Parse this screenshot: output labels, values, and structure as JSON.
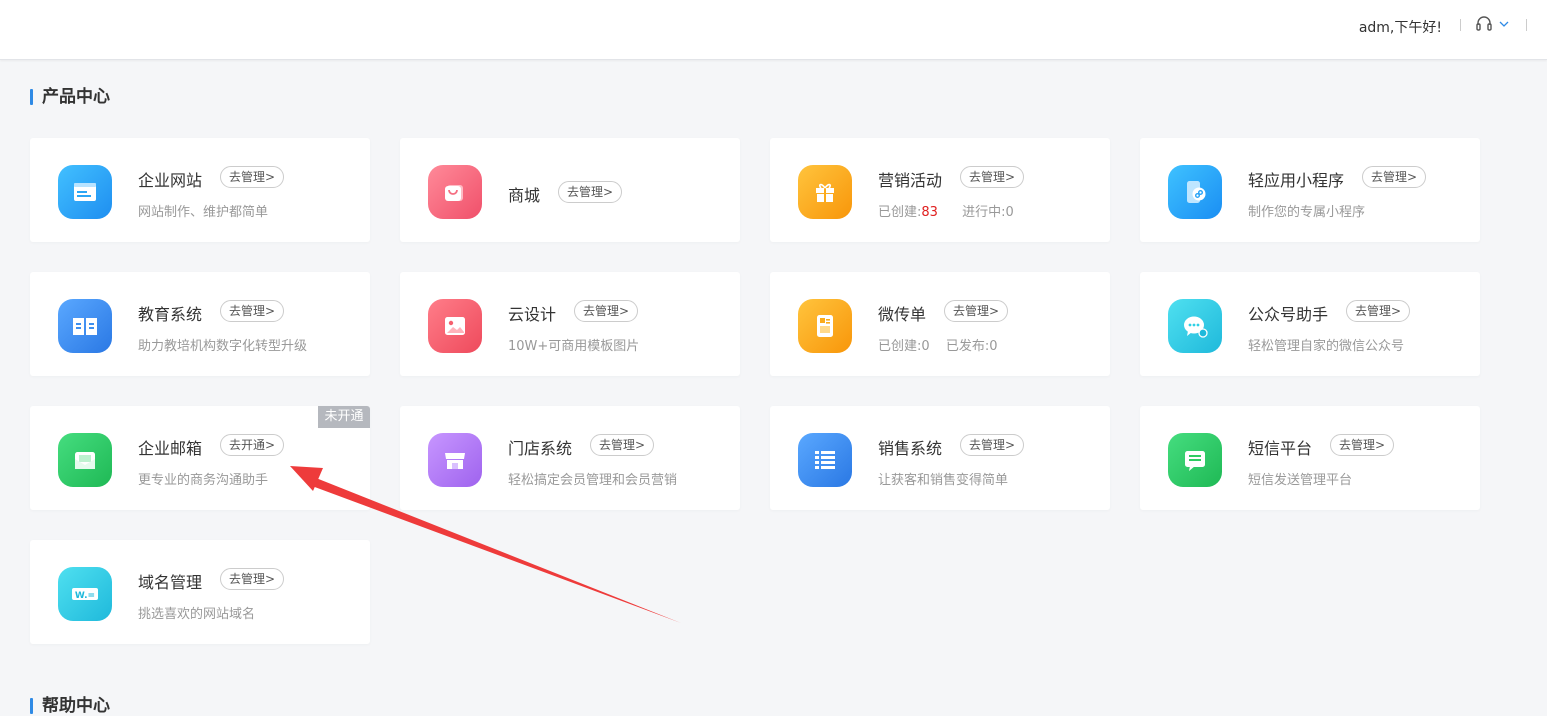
{
  "header": {
    "greeting": "adm,下午好!"
  },
  "product_center": {
    "title": "产品中心",
    "cards": [
      {
        "name": "企业网站",
        "action": "去管理>",
        "desc": "网站制作、维护都简单",
        "icon": "website-icon",
        "color": "#2ba6f5"
      },
      {
        "name": "商城",
        "action": "去管理>",
        "desc": "",
        "icon": "shopping-bag-icon",
        "color": "#f56f82"
      },
      {
        "name": "营销活动",
        "action": "去管理>",
        "stats": {
          "created_label": "已创建:",
          "created_value": "83",
          "progress_label": "进行中:",
          "progress_value": "0"
        },
        "icon": "gift-icon",
        "color": "#fbab1b"
      },
      {
        "name": "轻应用小程序",
        "action": "去管理>",
        "desc": "制作您的专属小程序",
        "icon": "mini-program-icon",
        "color": "#27a3f7"
      },
      {
        "name": "教育系统",
        "action": "去管理>",
        "desc": "助力教培机构数字化转型升级",
        "icon": "book-icon",
        "color": "#3d8fef"
      },
      {
        "name": "云设计",
        "action": "去管理>",
        "desc": "10W+可商用模板图片",
        "icon": "image-icon",
        "color": "#f5606e"
      },
      {
        "name": "微传单",
        "action": "去管理>",
        "stats": {
          "created_label": "已创建:",
          "created_value": "0",
          "published_label": "已发布:",
          "published_value": "0"
        },
        "icon": "flyer-icon",
        "color": "#fbab1b"
      },
      {
        "name": "公众号助手",
        "action": "去管理>",
        "desc": "轻松管理自家的微信公众号",
        "icon": "wechat-icon",
        "color": "#2fd1e6"
      },
      {
        "name": "企业邮箱",
        "action": "去开通>",
        "desc": "更专业的商务沟通助手",
        "badge": "未开通",
        "icon": "mail-icon",
        "color": "#2fcc6a"
      },
      {
        "name": "门店系统",
        "action": "去管理>",
        "desc": "轻松搞定会员管理和会员营销",
        "icon": "store-icon",
        "color": "#b57cf3"
      },
      {
        "name": "销售系统",
        "action": "去管理>",
        "desc": "让获客和销售变得简单",
        "icon": "list-icon",
        "color": "#3d8ff2"
      },
      {
        "name": "短信平台",
        "action": "去管理>",
        "desc": "短信发送管理平台",
        "icon": "sms-icon",
        "color": "#2fcc62"
      },
      {
        "name": "域名管理",
        "action": "去管理>",
        "desc": "挑选喜欢的网站域名",
        "icon": "domain-icon",
        "color": "#31d0e4"
      }
    ]
  },
  "help_center": {
    "title": "帮助中心"
  }
}
